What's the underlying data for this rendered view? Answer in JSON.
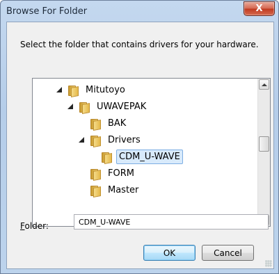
{
  "window": {
    "title": "Browse For Folder",
    "close_glyph": "X"
  },
  "instruction": "Select the folder that contains drivers for your hardware.",
  "tree": {
    "items": [
      {
        "label": "Mitutoyo",
        "level": 0,
        "expanded": true,
        "selected": false,
        "icon": "folder-icon"
      },
      {
        "label": "UWAVEPAK",
        "level": 1,
        "expanded": true,
        "selected": false,
        "icon": "folder-icon"
      },
      {
        "label": "BAK",
        "level": 2,
        "expanded": false,
        "selected": false,
        "icon": "folder-icon"
      },
      {
        "label": "Drivers",
        "level": 2,
        "expanded": true,
        "selected": false,
        "icon": "folder-icon"
      },
      {
        "label": "CDM_U-WAVE",
        "level": 3,
        "expanded": false,
        "selected": true,
        "icon": "folder-icon"
      },
      {
        "label": "FORM",
        "level": 2,
        "expanded": false,
        "selected": false,
        "icon": "folder-icon"
      },
      {
        "label": "Master",
        "level": 2,
        "expanded": false,
        "selected": false,
        "icon": "folder-icon"
      }
    ]
  },
  "folder": {
    "label_prefix": "F",
    "label_rest": "older:",
    "value": "CDM_U-WAVE"
  },
  "buttons": {
    "ok": "OK",
    "cancel": "Cancel"
  },
  "colors": {
    "title_bg": "#bcd3ec",
    "close_red": "#c0391f",
    "selection": "#d8eafb"
  }
}
